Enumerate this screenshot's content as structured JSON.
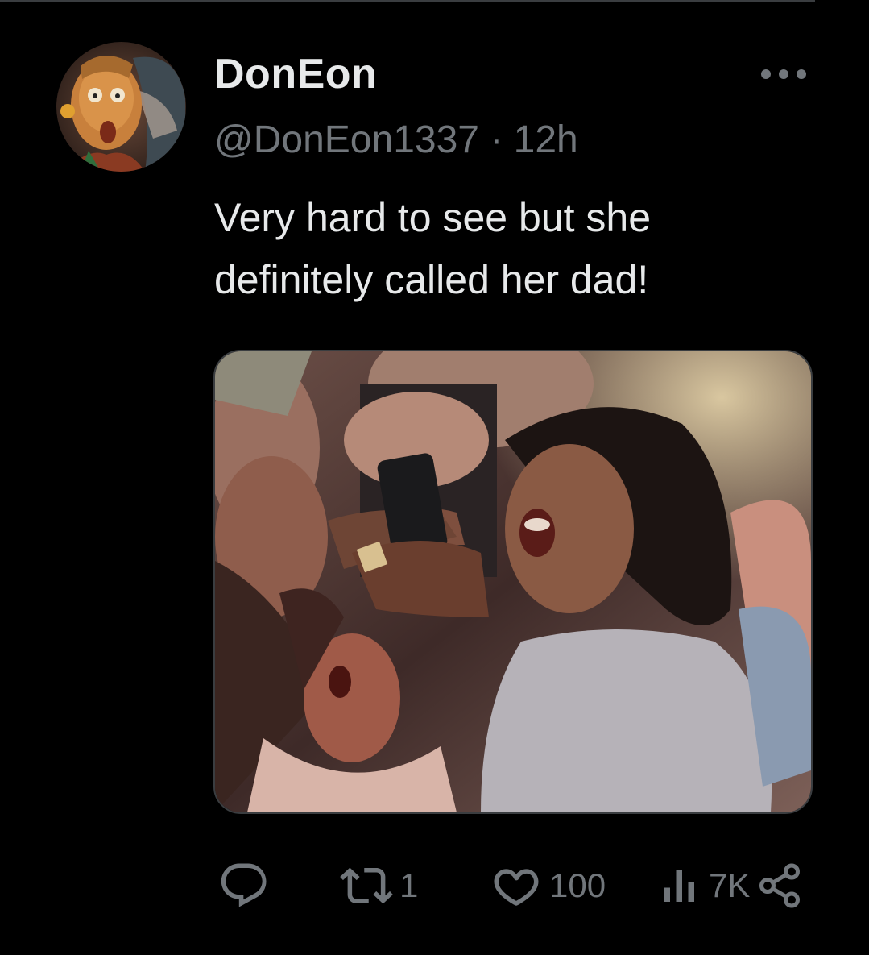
{
  "tweet": {
    "display_name": "DonEon",
    "handle": "@DonEon1337",
    "separator": "·",
    "time": "12h",
    "text_lines": [
      "Very hard to see but she",
      "definitely called her dad!"
    ],
    "media": {
      "kind": "video-still",
      "description_icon": "video-thumbnail"
    }
  },
  "actions": {
    "reply": {
      "icon": "reply-icon",
      "count": ""
    },
    "repost": {
      "icon": "repost-icon",
      "count": "1"
    },
    "like": {
      "icon": "heart-icon",
      "count": "100"
    },
    "views": {
      "icon": "views-icon",
      "count": "7K"
    },
    "share": {
      "icon": "share-icon"
    }
  },
  "colors": {
    "background": "#000000",
    "primary_text": "#e7e9ea",
    "secondary_text": "#71767b",
    "border": "#3a3d40"
  }
}
